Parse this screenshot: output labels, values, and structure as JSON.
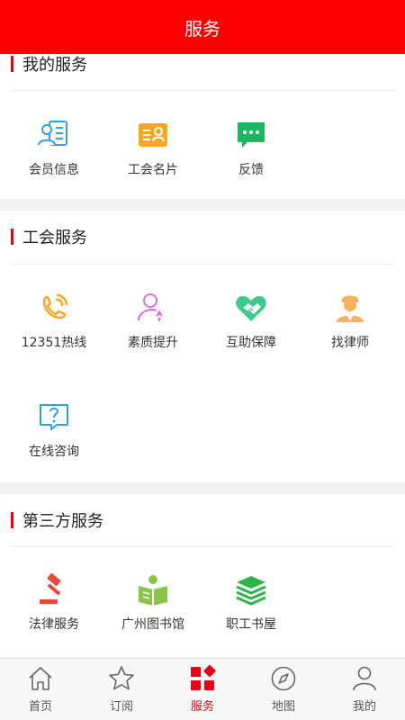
{
  "header": {
    "title": "服务"
  },
  "sections": [
    {
      "title": "我的服务",
      "items": [
        {
          "label": "会员信息",
          "icon": "member-card-icon"
        },
        {
          "label": "工会名片",
          "icon": "business-card-icon"
        },
        {
          "label": "反馈",
          "icon": "chat-bubble-icon"
        }
      ]
    },
    {
      "title": "工会服务",
      "items": [
        {
          "label": "12351热线",
          "icon": "hotline-phone-icon"
        },
        {
          "label": "素质提升",
          "icon": "user-rocket-icon"
        },
        {
          "label": "互助保障",
          "icon": "heart-handshake-icon"
        },
        {
          "label": "找律师",
          "icon": "lawyer-icon"
        },
        {
          "label": "在线咨询",
          "icon": "question-bubble-icon"
        }
      ]
    },
    {
      "title": "第三方服务",
      "items": [
        {
          "label": "法律服务",
          "icon": "gavel-icon"
        },
        {
          "label": "广州图书馆",
          "icon": "reader-book-icon"
        },
        {
          "label": "职工书屋",
          "icon": "book-stack-icon"
        }
      ]
    }
  ],
  "tabbar": {
    "active": "服务",
    "accent": "#e60012",
    "items": [
      {
        "label": "首页",
        "icon": "home-icon"
      },
      {
        "label": "订阅",
        "icon": "star-icon"
      },
      {
        "label": "服务",
        "icon": "grid-diamond-icon"
      },
      {
        "label": "地图",
        "icon": "compass-icon"
      },
      {
        "label": "我的",
        "icon": "user-icon"
      }
    ]
  },
  "colors": {
    "header": "#ff0000",
    "background": "#f2f2f2"
  }
}
